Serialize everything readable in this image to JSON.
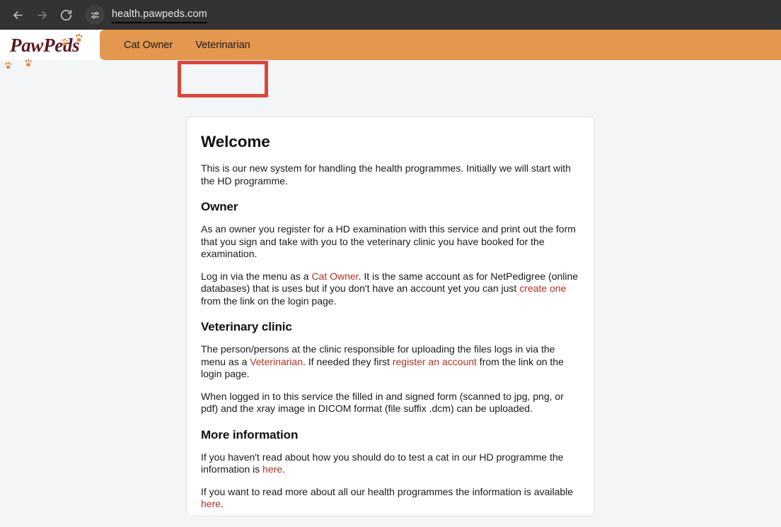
{
  "browser": {
    "back_icon": "arrow-left-icon",
    "forward_icon": "arrow-right-icon",
    "reload_icon": "reload-icon",
    "site_settings_icon": "tune-sliders-icon",
    "url": "health.pawpeds.com"
  },
  "header": {
    "logo_text": "PawPeds",
    "paw_icon": "paw-print-icon",
    "tabs": [
      {
        "label": "Cat Owner",
        "active": false
      },
      {
        "label": "Veterinarian",
        "active": true
      }
    ]
  },
  "annotation": {
    "target": "Veterinarian",
    "color": "#d9473c"
  },
  "colors": {
    "nav_orange": "#e3974f",
    "logo_maroon": "#5a1a20",
    "paw_orange": "#e08a42",
    "link_red": "#b03228",
    "page_bg": "#f4f5f7",
    "chrome_bg": "#333333"
  },
  "main": {
    "title": "Welcome",
    "intro": "This is our new system for handling the health programmes. Initially we will start with the HD programme.",
    "sections": [
      {
        "heading": "Owner",
        "paragraphs": [
          {
            "parts": [
              {
                "type": "text",
                "text": "As an owner you register for a HD examination with this service and print out the form that you sign and take with you to the veterinary clinic you have booked for the examination."
              }
            ]
          },
          {
            "parts": [
              {
                "type": "text",
                "text": "Log in via the menu as a "
              },
              {
                "type": "link",
                "text": "Cat Owner"
              },
              {
                "type": "text",
                "text": ". It is the same account as for NetPedigree (online databases) that is uses but if you don't have an account yet you can just "
              },
              {
                "type": "link",
                "text": "create one"
              },
              {
                "type": "text",
                "text": " from the link on the login page."
              }
            ]
          }
        ]
      },
      {
        "heading": "Veterinary clinic",
        "paragraphs": [
          {
            "parts": [
              {
                "type": "text",
                "text": "The person/persons at the clinic responsible for uploading the files logs in via the menu as a "
              },
              {
                "type": "link",
                "text": "Veterinarian"
              },
              {
                "type": "text",
                "text": ". If needed they first "
              },
              {
                "type": "link",
                "text": "register an account"
              },
              {
                "type": "text",
                "text": " from the link on the login page."
              }
            ]
          },
          {
            "parts": [
              {
                "type": "text",
                "text": "When logged in to this service the filled in and signed form (scanned to jpg, png, or pdf) and the xray image in DICOM format (file suffix .dcm) can be uploaded."
              }
            ]
          }
        ]
      },
      {
        "heading": "More information",
        "paragraphs": [
          {
            "parts": [
              {
                "type": "text",
                "text": "If you haven't read about how you should do to test a cat in our HD programme the information is "
              },
              {
                "type": "link",
                "text": "here"
              },
              {
                "type": "text",
                "text": "."
              }
            ]
          },
          {
            "parts": [
              {
                "type": "text",
                "text": "If you want to read more about all our health programmes the information is available "
              },
              {
                "type": "link",
                "text": "here"
              },
              {
                "type": "text",
                "text": "."
              }
            ]
          }
        ]
      }
    ]
  }
}
